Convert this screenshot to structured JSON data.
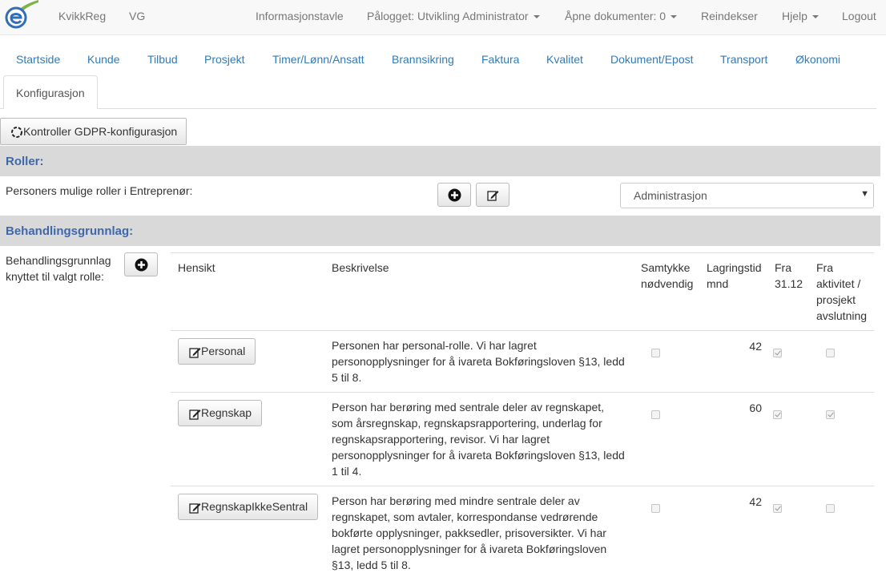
{
  "navbar": {
    "brand": "KvikkReg",
    "vg": "VG",
    "links": {
      "dashboard": "Informasjonstavle",
      "logged_in": "Pålogget: Utvikling Administrator",
      "open_docs": "Åpne dokumenter: 0",
      "reindex": "Reindekser",
      "help": "Hjelp",
      "logout": "Logout"
    }
  },
  "tabs": [
    "Startside",
    "Kunde",
    "Tilbud",
    "Prosjekt",
    "Timer/Lønn/Ansatt",
    "Brannsikring",
    "Faktura",
    "Kvalitet",
    "Dokument/Epost",
    "Transport",
    "Økonomi"
  ],
  "active_tab": "Konfigurasjon",
  "gdpr_button": "Kontroller GDPR-konfigurasjon",
  "roles": {
    "header": "Roller:",
    "label": "Personers mulige roller i Entreprenør:",
    "selected_role": "Administrasjon"
  },
  "basis": {
    "header": "Behandlingsgrunnlag:",
    "label_line1": "Behandlingsgrunnlag",
    "label_line2": "knyttet til valgt rolle:",
    "columns": {
      "purpose": "Hensikt",
      "description": "Beskrivelse",
      "consent": [
        "Samtykke",
        "nødvendig"
      ],
      "retention": [
        "Lagringstid",
        "mnd"
      ],
      "from_date": [
        "Fra",
        "31.12"
      ],
      "from_activity": [
        "Fra",
        "aktivitet /",
        "prosjekt",
        "avslutning"
      ]
    },
    "rows": [
      {
        "purpose": "Personal",
        "description": [
          "Personen har personal-rolle. Vi har lagret",
          "personopplysninger for å ivareta Bokføringsloven §13, ledd",
          "5 til 8."
        ],
        "retention": "42",
        "consent_required": false,
        "from_date": true,
        "from_activity": false
      },
      {
        "purpose": "Regnskap",
        "description": [
          "Person har berøring med sentrale deler av regnskapet,",
          "som årsregnskap, regnskapsrapportering, underlag for",
          "regnskapsrapportering, revisor. Vi har lagret",
          "personopplysninger for å ivareta Bokføringsloven §13, ledd",
          "1 til 4."
        ],
        "retention": "60",
        "consent_required": false,
        "from_date": true,
        "from_activity": true
      },
      {
        "purpose": "RegnskapIkkeSentral",
        "description": [
          "Person har berøring med mindre sentrale deler av",
          "regnskapet, som avtaler, korrespondanse vedrørende",
          "bokførte opplysninger, pakksedler, prisoversikter. Vi har",
          "lagret personopplysninger for å ivareta Bokføringsloven",
          "§13, ledd 5 til 8."
        ],
        "retention": "42",
        "consent_required": false,
        "from_date": true,
        "from_activity": false
      }
    ]
  }
}
